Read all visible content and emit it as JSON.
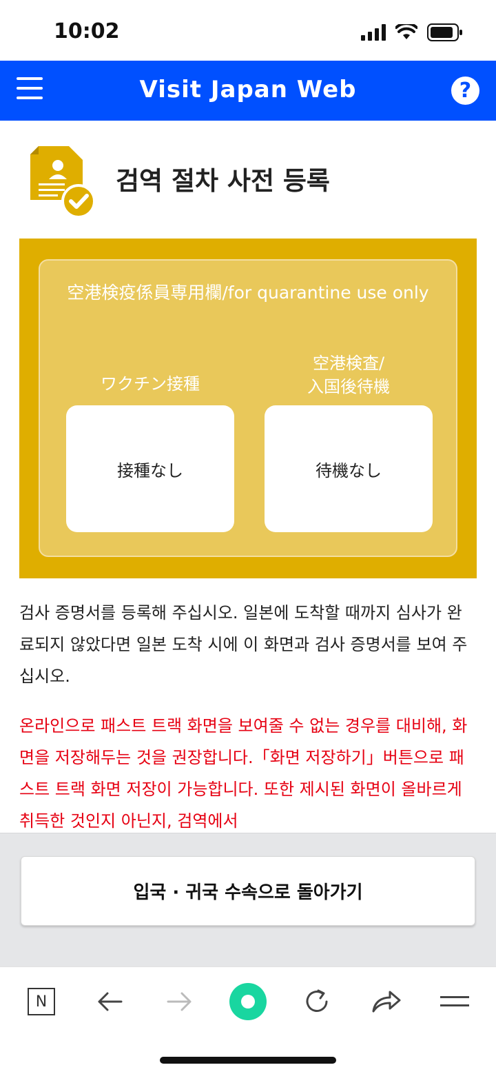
{
  "status_bar": {
    "time": "10:02"
  },
  "header": {
    "title": "Visit Japan Web",
    "help_label": "?"
  },
  "page": {
    "title": "검역 절차 사전 등록"
  },
  "quarantine": {
    "heading": "空港検疫係員専用欄/for quarantine use only",
    "vaccine_label": "ワクチン接種",
    "vaccine_value": "接種なし",
    "test_label_line1": "空港検査/",
    "test_label_line2": "入国後待機",
    "test_value": "待機なし",
    "colors": {
      "outer": "#dfae00",
      "inner": "#e9c85a"
    }
  },
  "description": "검사 증명서를 등록해 주십시오. 일본에 도착할 때까지 심사가 완료되지 않았다면 일본 도착 시에 이 화면과 검사 증명서를 보여 주십시오.",
  "warning": "온라인으로 패스트 트랙 화면을 보여줄 수 없는 경우를 대비해, 화면을 저장해두는 것을 권장합니다.「화면 저장하기」버튼으로 패스트 트랙 화면 저장이 가능합니다. 또한 제시된 화면이 올바르게 취득한 것인지 아닌지, 검역에서",
  "footer": {
    "back_button_label": "입국 · 귀국 수속으로 돌아가기"
  },
  "browser_bar": {
    "home_label": "N",
    "icons": [
      "n-home-icon",
      "back-arrow-icon",
      "forward-arrow-icon",
      "green-dot-icon",
      "reload-icon",
      "share-icon",
      "menu-lines-icon"
    ]
  },
  "theme": {
    "brand_blue": "#0050ff",
    "warning_red": "#e60012",
    "gold": "#dfae00"
  }
}
